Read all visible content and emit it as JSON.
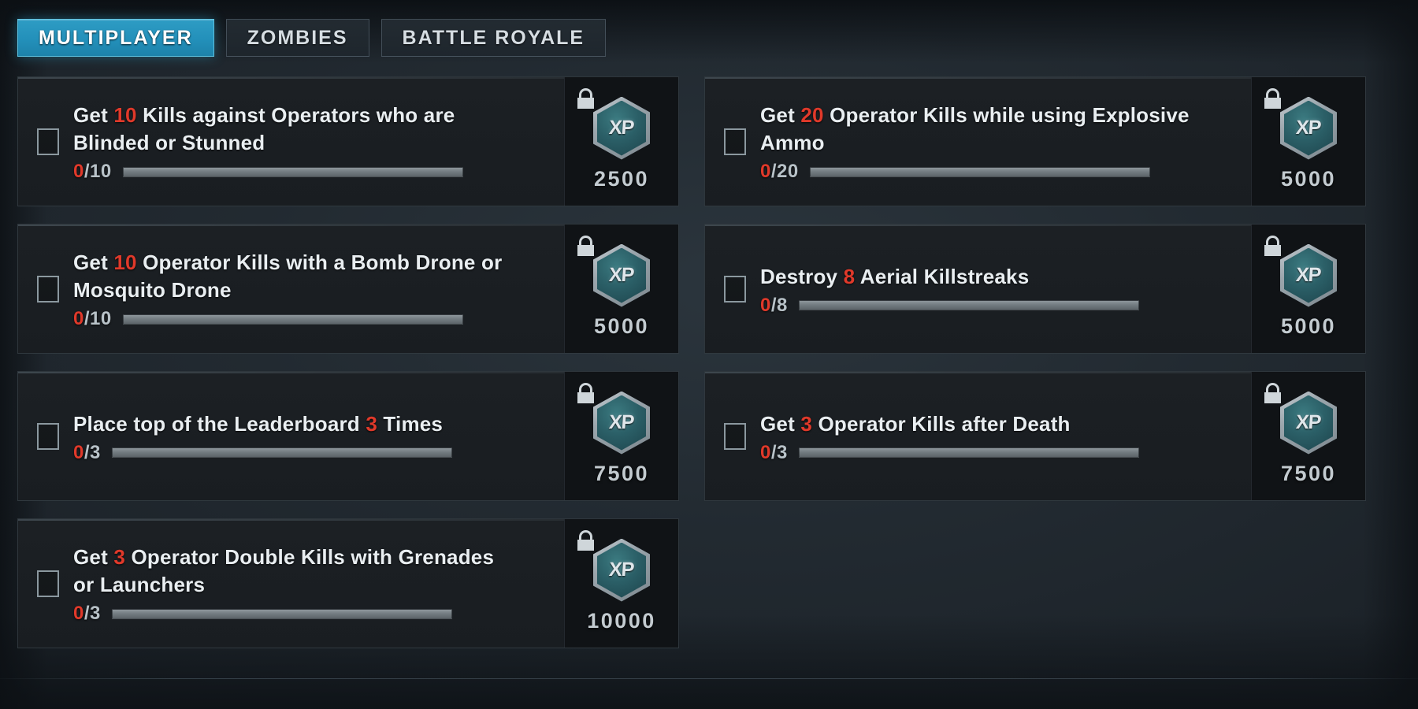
{
  "tabs": [
    {
      "label": "MULTIPLAYER",
      "active": true
    },
    {
      "label": "ZOMBIES",
      "active": false
    },
    {
      "label": "BATTLE ROYALE",
      "active": false
    }
  ],
  "reward_icon_label": "XP",
  "lock_icon": "unlocked-padlock-icon",
  "accent_color": "#2390ba",
  "amount_color": "#e0392a",
  "columns": [
    {
      "name": "left-column",
      "challenges": [
        {
          "title_pre": "Get ",
          "amount": "10",
          "title_post": " Kills against Operators who are Blinded or Stunned",
          "current": "0",
          "goal": "10",
          "progress_text": "0/10",
          "progress_percent": 0,
          "reward_xp": "2500",
          "locked": true,
          "completed": false
        },
        {
          "title_pre": "Get ",
          "amount": "10",
          "title_post": " Operator Kills with a Bomb Drone or Mosquito Drone",
          "current": "0",
          "goal": "10",
          "progress_text": "0/10",
          "progress_percent": 0,
          "reward_xp": "5000",
          "locked": true,
          "completed": false
        },
        {
          "title_pre": "Place top of the Leaderboard ",
          "amount": "3",
          "title_post": " Times",
          "current": "0",
          "goal": "3",
          "progress_text": "0/3",
          "progress_percent": 0,
          "reward_xp": "7500",
          "locked": true,
          "completed": false
        },
        {
          "title_pre": "Get ",
          "amount": "3",
          "title_post": " Operator Double Kills with Grenades or Launchers",
          "current": "0",
          "goal": "3",
          "progress_text": "0/3",
          "progress_percent": 0,
          "reward_xp": "10000",
          "locked": true,
          "completed": false
        }
      ]
    },
    {
      "name": "right-column",
      "challenges": [
        {
          "title_pre": "Get ",
          "amount": "20",
          "title_post": " Operator Kills while using Explosive Ammo",
          "current": "0",
          "goal": "20",
          "progress_text": "0/20",
          "progress_percent": 0,
          "reward_xp": "5000",
          "locked": true,
          "completed": false
        },
        {
          "title_pre": "Destroy ",
          "amount": "8",
          "title_post": " Aerial Killstreaks",
          "current": "0",
          "goal": "8",
          "progress_text": "0/8",
          "progress_percent": 0,
          "reward_xp": "5000",
          "locked": true,
          "completed": false
        },
        {
          "title_pre": "Get ",
          "amount": "3",
          "title_post": " Operator Kills after Death",
          "current": "0",
          "goal": "3",
          "progress_text": "0/3",
          "progress_percent": 0,
          "reward_xp": "7500",
          "locked": true,
          "completed": false
        }
      ]
    }
  ]
}
